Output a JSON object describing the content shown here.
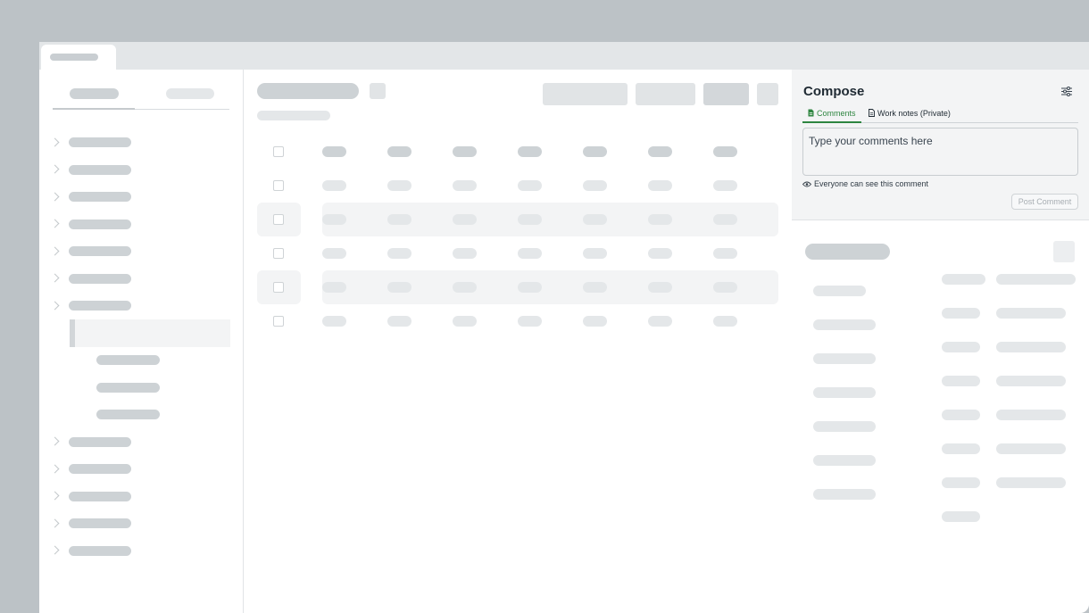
{
  "compose": {
    "title": "Compose",
    "tabs": [
      {
        "label": "Comments",
        "active": true
      },
      {
        "label": "Work notes (Private)",
        "active": false
      }
    ],
    "comment_placeholder": "Type your comments here",
    "visibility_text": "Everyone can see this comment",
    "post_label": "Post Comment"
  },
  "colors": {
    "accent_green": "#2e8540",
    "skeleton": "#cdd2d5",
    "background": "#bcc2c6"
  },
  "icons": {
    "settings": "sliders-icon",
    "comments_tab": "document-icon",
    "worknotes_tab": "document-outline-icon",
    "visibility": "eye-icon"
  }
}
